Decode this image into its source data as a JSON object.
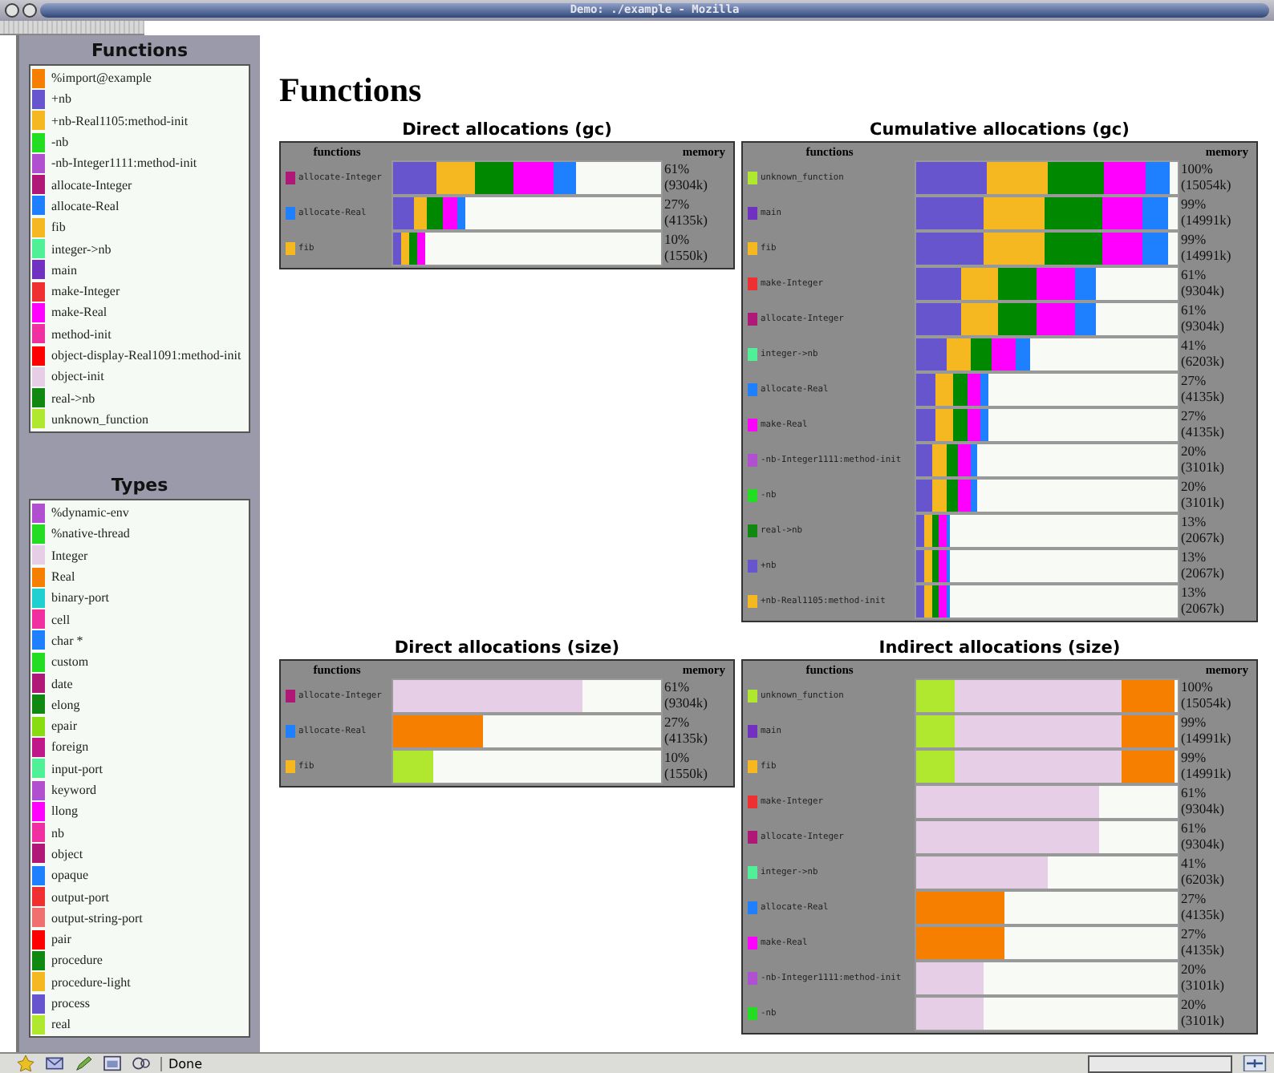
{
  "window": {
    "title": "Demo: ./example - Mozilla"
  },
  "sidebar": {
    "sections": [
      {
        "heading": "Functions",
        "items": [
          {
            "label": "%import@example",
            "color": "#f77f00"
          },
          {
            "label": "+nb",
            "color": "#6655cc"
          },
          {
            "label": "+nb-Real1105:method-init",
            "color": "#f5b820"
          },
          {
            "label": "-nb",
            "color": "#22dd22"
          },
          {
            "label": "-nb-Integer1111:method-init",
            "color": "#b050d0"
          },
          {
            "label": "allocate-Integer",
            "color": "#b01878"
          },
          {
            "label": "allocate-Real",
            "color": "#1e80ff"
          },
          {
            "label": "fib",
            "color": "#f5b820"
          },
          {
            "label": "integer->nb",
            "color": "#50f098"
          },
          {
            "label": "main",
            "color": "#7030c0"
          },
          {
            "label": "make-Integer",
            "color": "#f03030"
          },
          {
            "label": "make-Real",
            "color": "#ff00ff"
          },
          {
            "label": "method-init",
            "color": "#f030a0"
          },
          {
            "label": "object-display-Real1091:method-init",
            "color": "#ff0000"
          },
          {
            "label": "object-init",
            "color": "#e6cfe6"
          },
          {
            "label": "real->nb",
            "color": "#118811"
          },
          {
            "label": "unknown_function",
            "color": "#b0e830"
          }
        ]
      },
      {
        "heading": "Types",
        "items": [
          {
            "label": "%dynamic-env",
            "color": "#b050d0"
          },
          {
            "label": "%native-thread",
            "color": "#22dd22"
          },
          {
            "label": "Integer",
            "color": "#e6cfe6"
          },
          {
            "label": "Real",
            "color": "#f77f00"
          },
          {
            "label": "binary-port",
            "color": "#20d0d0"
          },
          {
            "label": "cell",
            "color": "#f030a0"
          },
          {
            "label": "char *",
            "color": "#1e80ff"
          },
          {
            "label": "custom",
            "color": "#22dd22"
          },
          {
            "label": "date",
            "color": "#b01878"
          },
          {
            "label": "elong",
            "color": "#118811"
          },
          {
            "label": "epair",
            "color": "#88dd10"
          },
          {
            "label": "foreign",
            "color": "#c01888"
          },
          {
            "label": "input-port",
            "color": "#50f098"
          },
          {
            "label": "keyword",
            "color": "#b050d0"
          },
          {
            "label": "llong",
            "color": "#ff00ff"
          },
          {
            "label": "nb",
            "color": "#f030a0"
          },
          {
            "label": "object",
            "color": "#b01878"
          },
          {
            "label": "opaque",
            "color": "#1e80ff"
          },
          {
            "label": "output-port",
            "color": "#f03030"
          },
          {
            "label": "output-string-port",
            "color": "#f07070"
          },
          {
            "label": "pair",
            "color": "#ff0000"
          },
          {
            "label": "procedure",
            "color": "#118811"
          },
          {
            "label": "procedure-light",
            "color": "#f5b820"
          },
          {
            "label": "process",
            "color": "#6655cc"
          },
          {
            "label": "real",
            "color": "#b0e830"
          }
        ]
      }
    ]
  },
  "page": {
    "heading": "Functions"
  },
  "charts": [
    {
      "title": "Direct allocations (gc)",
      "columns": [
        "functions",
        "memory"
      ],
      "rows": [
        {
          "name": "allocate-Integer",
          "color": "#b01878",
          "segments": [
            {
              "color": "#6655cc"
            },
            {
              "color": "#f5b820"
            },
            {
              "color": "#008800"
            },
            {
              "color": "#ff00ff"
            },
            {
              "color": "#1e80ff"
            }
          ],
          "percent": "61%",
          "amount": "(9304k)"
        },
        {
          "name": "allocate-Real",
          "color": "#1e80ff",
          "segments": [
            {
              "color": "#6655cc"
            },
            {
              "color": "#f5b820"
            },
            {
              "color": "#008800"
            },
            {
              "color": "#ff00ff"
            },
            {
              "color": "#1e80ff"
            }
          ],
          "percent": "27%",
          "amount": "(4135k)"
        },
        {
          "name": "fib",
          "color": "#f5b820",
          "segments": [
            {
              "color": "#6655cc"
            },
            {
              "color": "#f5b820"
            },
            {
              "color": "#008800"
            },
            {
              "color": "#ff00ff"
            }
          ],
          "percent": "10%",
          "amount": "(1550k)"
        }
      ]
    },
    {
      "title": "Cumulative allocations (gc)",
      "columns": [
        "functions",
        "memory"
      ],
      "rows": [
        {
          "name": "unknown_function",
          "color": "#b0e830",
          "segments": [
            {
              "color": "#6655cc"
            },
            {
              "color": "#f5b820"
            },
            {
              "color": "#008800"
            },
            {
              "color": "#ff00ff"
            },
            {
              "color": "#1e80ff"
            }
          ],
          "percent": "100%",
          "amount": "(15054k)"
        },
        {
          "name": "main",
          "color": "#7030c0",
          "segments": [
            {
              "color": "#6655cc"
            },
            {
              "color": "#f5b820"
            },
            {
              "color": "#008800"
            },
            {
              "color": "#ff00ff"
            },
            {
              "color": "#1e80ff"
            }
          ],
          "percent": "99%",
          "amount": "(14991k)"
        },
        {
          "name": "fib",
          "color": "#f5b820",
          "segments": [
            {
              "color": "#6655cc"
            },
            {
              "color": "#f5b820"
            },
            {
              "color": "#008800"
            },
            {
              "color": "#ff00ff"
            },
            {
              "color": "#1e80ff"
            }
          ],
          "percent": "99%",
          "amount": "(14991k)"
        },
        {
          "name": "make-Integer",
          "color": "#f03030",
          "segments": [
            {
              "color": "#6655cc"
            },
            {
              "color": "#f5b820"
            },
            {
              "color": "#008800"
            },
            {
              "color": "#ff00ff"
            },
            {
              "color": "#1e80ff"
            }
          ],
          "percent": "61%",
          "amount": "(9304k)"
        },
        {
          "name": "allocate-Integer",
          "color": "#b01878",
          "segments": [
            {
              "color": "#6655cc"
            },
            {
              "color": "#f5b820"
            },
            {
              "color": "#008800"
            },
            {
              "color": "#ff00ff"
            },
            {
              "color": "#1e80ff"
            }
          ],
          "percent": "61%",
          "amount": "(9304k)"
        },
        {
          "name": "integer->nb",
          "color": "#50f098",
          "segments": [
            {
              "color": "#6655cc"
            },
            {
              "color": "#f5b820"
            },
            {
              "color": "#008800"
            },
            {
              "color": "#ff00ff"
            },
            {
              "color": "#1e80ff"
            }
          ],
          "percent": "41%",
          "amount": "(6203k)"
        },
        {
          "name": "allocate-Real",
          "color": "#1e80ff",
          "segments": [
            {
              "color": "#6655cc"
            },
            {
              "color": "#f5b820"
            },
            {
              "color": "#008800"
            },
            {
              "color": "#ff00ff"
            },
            {
              "color": "#1e80ff"
            }
          ],
          "percent": "27%",
          "amount": "(4135k)"
        },
        {
          "name": "make-Real",
          "color": "#ff00ff",
          "segments": [
            {
              "color": "#6655cc"
            },
            {
              "color": "#f5b820"
            },
            {
              "color": "#008800"
            },
            {
              "color": "#ff00ff"
            },
            {
              "color": "#1e80ff"
            }
          ],
          "percent": "27%",
          "amount": "(4135k)"
        },
        {
          "name": "-nb-Integer1111:method-init",
          "color": "#b050d0",
          "segments": [
            {
              "color": "#6655cc"
            },
            {
              "color": "#f5b820"
            },
            {
              "color": "#008800"
            },
            {
              "color": "#ff00ff"
            },
            {
              "color": "#1e80ff"
            }
          ],
          "percent": "20%",
          "amount": "(3101k)"
        },
        {
          "name": "-nb",
          "color": "#22dd22",
          "segments": [
            {
              "color": "#6655cc"
            },
            {
              "color": "#f5b820"
            },
            {
              "color": "#008800"
            },
            {
              "color": "#ff00ff"
            },
            {
              "color": "#1e80ff"
            }
          ],
          "percent": "20%",
          "amount": "(3101k)"
        },
        {
          "name": "real->nb",
          "color": "#118811",
          "segments": [
            {
              "color": "#6655cc"
            },
            {
              "color": "#f5b820"
            },
            {
              "color": "#008800"
            },
            {
              "color": "#ff00ff"
            },
            {
              "color": "#1e80ff"
            }
          ],
          "percent": "13%",
          "amount": "(2067k)"
        },
        {
          "name": "+nb",
          "color": "#6655cc",
          "segments": [
            {
              "color": "#6655cc"
            },
            {
              "color": "#f5b820"
            },
            {
              "color": "#008800"
            },
            {
              "color": "#ff00ff"
            },
            {
              "color": "#1e80ff"
            }
          ],
          "percent": "13%",
          "amount": "(2067k)"
        },
        {
          "name": "+nb-Real1105:method-init",
          "color": "#f5b820",
          "segments": [
            {
              "color": "#6655cc"
            },
            {
              "color": "#f5b820"
            },
            {
              "color": "#008800"
            },
            {
              "color": "#ff00ff"
            },
            {
              "color": "#1e80ff"
            }
          ],
          "percent": "13%",
          "amount": "(2067k)"
        }
      ]
    },
    {
      "title": "Direct allocations (size)",
      "columns": [
        "functions",
        "memory"
      ],
      "rows": [
        {
          "name": "allocate-Integer",
          "color": "#b01878",
          "segments": [
            {
              "color": "#e6cfe6"
            }
          ],
          "percent": "61%",
          "amount": "(9304k)"
        },
        {
          "name": "allocate-Real",
          "color": "#1e80ff",
          "segments": [
            {
              "color": "#f77f00"
            }
          ],
          "percent": "27%",
          "amount": "(4135k)"
        },
        {
          "name": "fib",
          "color": "#f5b820",
          "segments": [
            {
              "color": "#b0e830"
            }
          ],
          "percent": "10%",
          "amount": "(1550k)"
        }
      ]
    },
    {
      "title": "Indirect allocations (size)",
      "columns": [
        "functions",
        "memory"
      ],
      "rows": [
        {
          "name": "unknown_function",
          "color": "#b0e830",
          "segments": [
            {
              "color": "#b0e830"
            },
            {
              "color": "#e6cfe6"
            },
            {
              "color": "#f77f00"
            }
          ],
          "percent": "100%",
          "amount": "(15054k)"
        },
        {
          "name": "main",
          "color": "#7030c0",
          "segments": [
            {
              "color": "#b0e830"
            },
            {
              "color": "#e6cfe6"
            },
            {
              "color": "#f77f00"
            }
          ],
          "percent": "99%",
          "amount": "(14991k)"
        },
        {
          "name": "fib",
          "color": "#f5b820",
          "segments": [
            {
              "color": "#b0e830"
            },
            {
              "color": "#e6cfe6"
            },
            {
              "color": "#f77f00"
            }
          ],
          "percent": "99%",
          "amount": "(14991k)"
        },
        {
          "name": "make-Integer",
          "color": "#f03030",
          "segments": [
            {
              "color": "#e6cfe6"
            }
          ],
          "percent": "61%",
          "amount": "(9304k)"
        },
        {
          "name": "allocate-Integer",
          "color": "#b01878",
          "segments": [
            {
              "color": "#e6cfe6"
            }
          ],
          "percent": "61%",
          "amount": "(9304k)"
        },
        {
          "name": "integer->nb",
          "color": "#50f098",
          "segments": [
            {
              "color": "#e6cfe6"
            }
          ],
          "percent": "41%",
          "amount": "(6203k)"
        },
        {
          "name": "allocate-Real",
          "color": "#1e80ff",
          "segments": [
            {
              "color": "#f77f00"
            }
          ],
          "percent": "27%",
          "amount": "(4135k)"
        },
        {
          "name": "make-Real",
          "color": "#ff00ff",
          "segments": [
            {
              "color": "#f77f00"
            }
          ],
          "percent": "27%",
          "amount": "(4135k)"
        },
        {
          "name": "-nb-Integer1111:method-init",
          "color": "#b050d0",
          "segments": [
            {
              "color": "#e6cfe6"
            }
          ],
          "percent": "20%",
          "amount": "(3101k)"
        },
        {
          "name": "-nb",
          "color": "#22dd22",
          "segments": [
            {
              "color": "#e6cfe6"
            }
          ],
          "percent": "20%",
          "amount": "(3101k)"
        }
      ]
    }
  ],
  "status_bar": {
    "text": "Done"
  }
}
